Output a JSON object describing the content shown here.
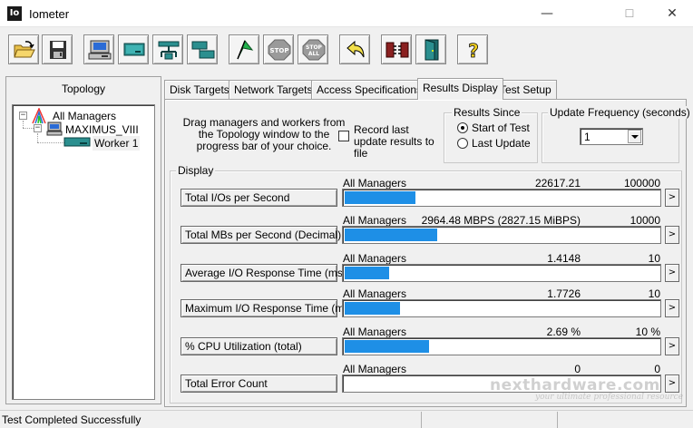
{
  "window": {
    "title": "Iometer",
    "icon_text": "Io",
    "minimize": "—",
    "maximize": "☐",
    "close": "✕"
  },
  "toolbar": {
    "buttons": [
      {
        "name": "open-config-button",
        "icon": "folder-open-icon"
      },
      {
        "name": "save-config-button",
        "icon": "floppy-disk-icon"
      },
      {
        "name": "new-disk-worker-button",
        "icon": "computer-disk-icon"
      },
      {
        "name": "new-network-worker-button",
        "icon": "network-computer-icon"
      },
      {
        "name": "add-network-button",
        "icon": "network-tree-icon"
      },
      {
        "name": "duplicate-worker-button",
        "icon": "duplicate-worker-icon"
      },
      {
        "name": "start-tests-button",
        "icon": "green-flag-icon"
      },
      {
        "name": "stop-button",
        "icon": "stop-sign-icon",
        "label": "STOP"
      },
      {
        "name": "stop-all-button",
        "icon": "stop-all-sign-icon",
        "label": "STOP ALL"
      },
      {
        "name": "reset-workers-button",
        "icon": "reset-arrow-icon"
      },
      {
        "name": "disconnect-button",
        "icon": "disconnect-icon"
      },
      {
        "name": "exit-button",
        "icon": "exit-door-icon"
      },
      {
        "name": "about-button",
        "icon": "question-mark-icon",
        "label": "?"
      }
    ]
  },
  "topology": {
    "title": "Topology",
    "tree": {
      "root": "All Managers",
      "manager": "MAXIMUS_VIII",
      "worker": "Worker 1"
    }
  },
  "tabs": [
    {
      "label": "Disk Targets",
      "active": false
    },
    {
      "label": "Network Targets",
      "active": false
    },
    {
      "label": "Access Specifications",
      "active": false
    },
    {
      "label": "Results Display",
      "active": true
    },
    {
      "label": "Test Setup",
      "active": false
    }
  ],
  "results": {
    "drag_instructions": "Drag managers and workers from the Topology window to the progress bar of your choice.",
    "record_label": "Record last update results to file",
    "record_checked": false,
    "results_since": {
      "title": "Results Since",
      "options": [
        "Start of Test",
        "Last Update"
      ],
      "selected": "Start of Test"
    },
    "update_frequency": {
      "title": "Update Frequency (seconds)",
      "value": "1"
    },
    "display_title": "Display",
    "arrow": ">",
    "metrics": [
      {
        "label": "Total I/Os per Second",
        "source": "All Managers",
        "value": "22617.21",
        "max": "100000",
        "fill": 0.226
      },
      {
        "label": "Total MBs per Second (Decimal)",
        "source": "All Managers",
        "value": "2964.48 MBPS (2827.15 MiBPS)",
        "max": "10000",
        "fill": 0.296
      },
      {
        "label": "Average I/O Response Time (ms)",
        "source": "All Managers",
        "value": "1.4148",
        "max": "10",
        "fill": 0.141
      },
      {
        "label": "Maximum I/O Response Time (ms)",
        "source": "All Managers",
        "value": "1.7726",
        "max": "10",
        "fill": 0.177
      },
      {
        "label": "% CPU Utilization (total)",
        "source": "All Managers",
        "value": "2.69 %",
        "max": "10 %",
        "fill": 0.269
      },
      {
        "label": "Total Error Count",
        "source": "All Managers",
        "value": "0",
        "max": "0",
        "fill": 0
      }
    ]
  },
  "status": {
    "text": "Test Completed Successfully"
  },
  "watermark": {
    "brand": "nexthardware.com",
    "tagline": "your ultimate professional resource"
  },
  "colors": {
    "bar_fill": "#1e8fe6",
    "flag_green": "#22b14c",
    "stop_gray": "#9a9a9a"
  }
}
